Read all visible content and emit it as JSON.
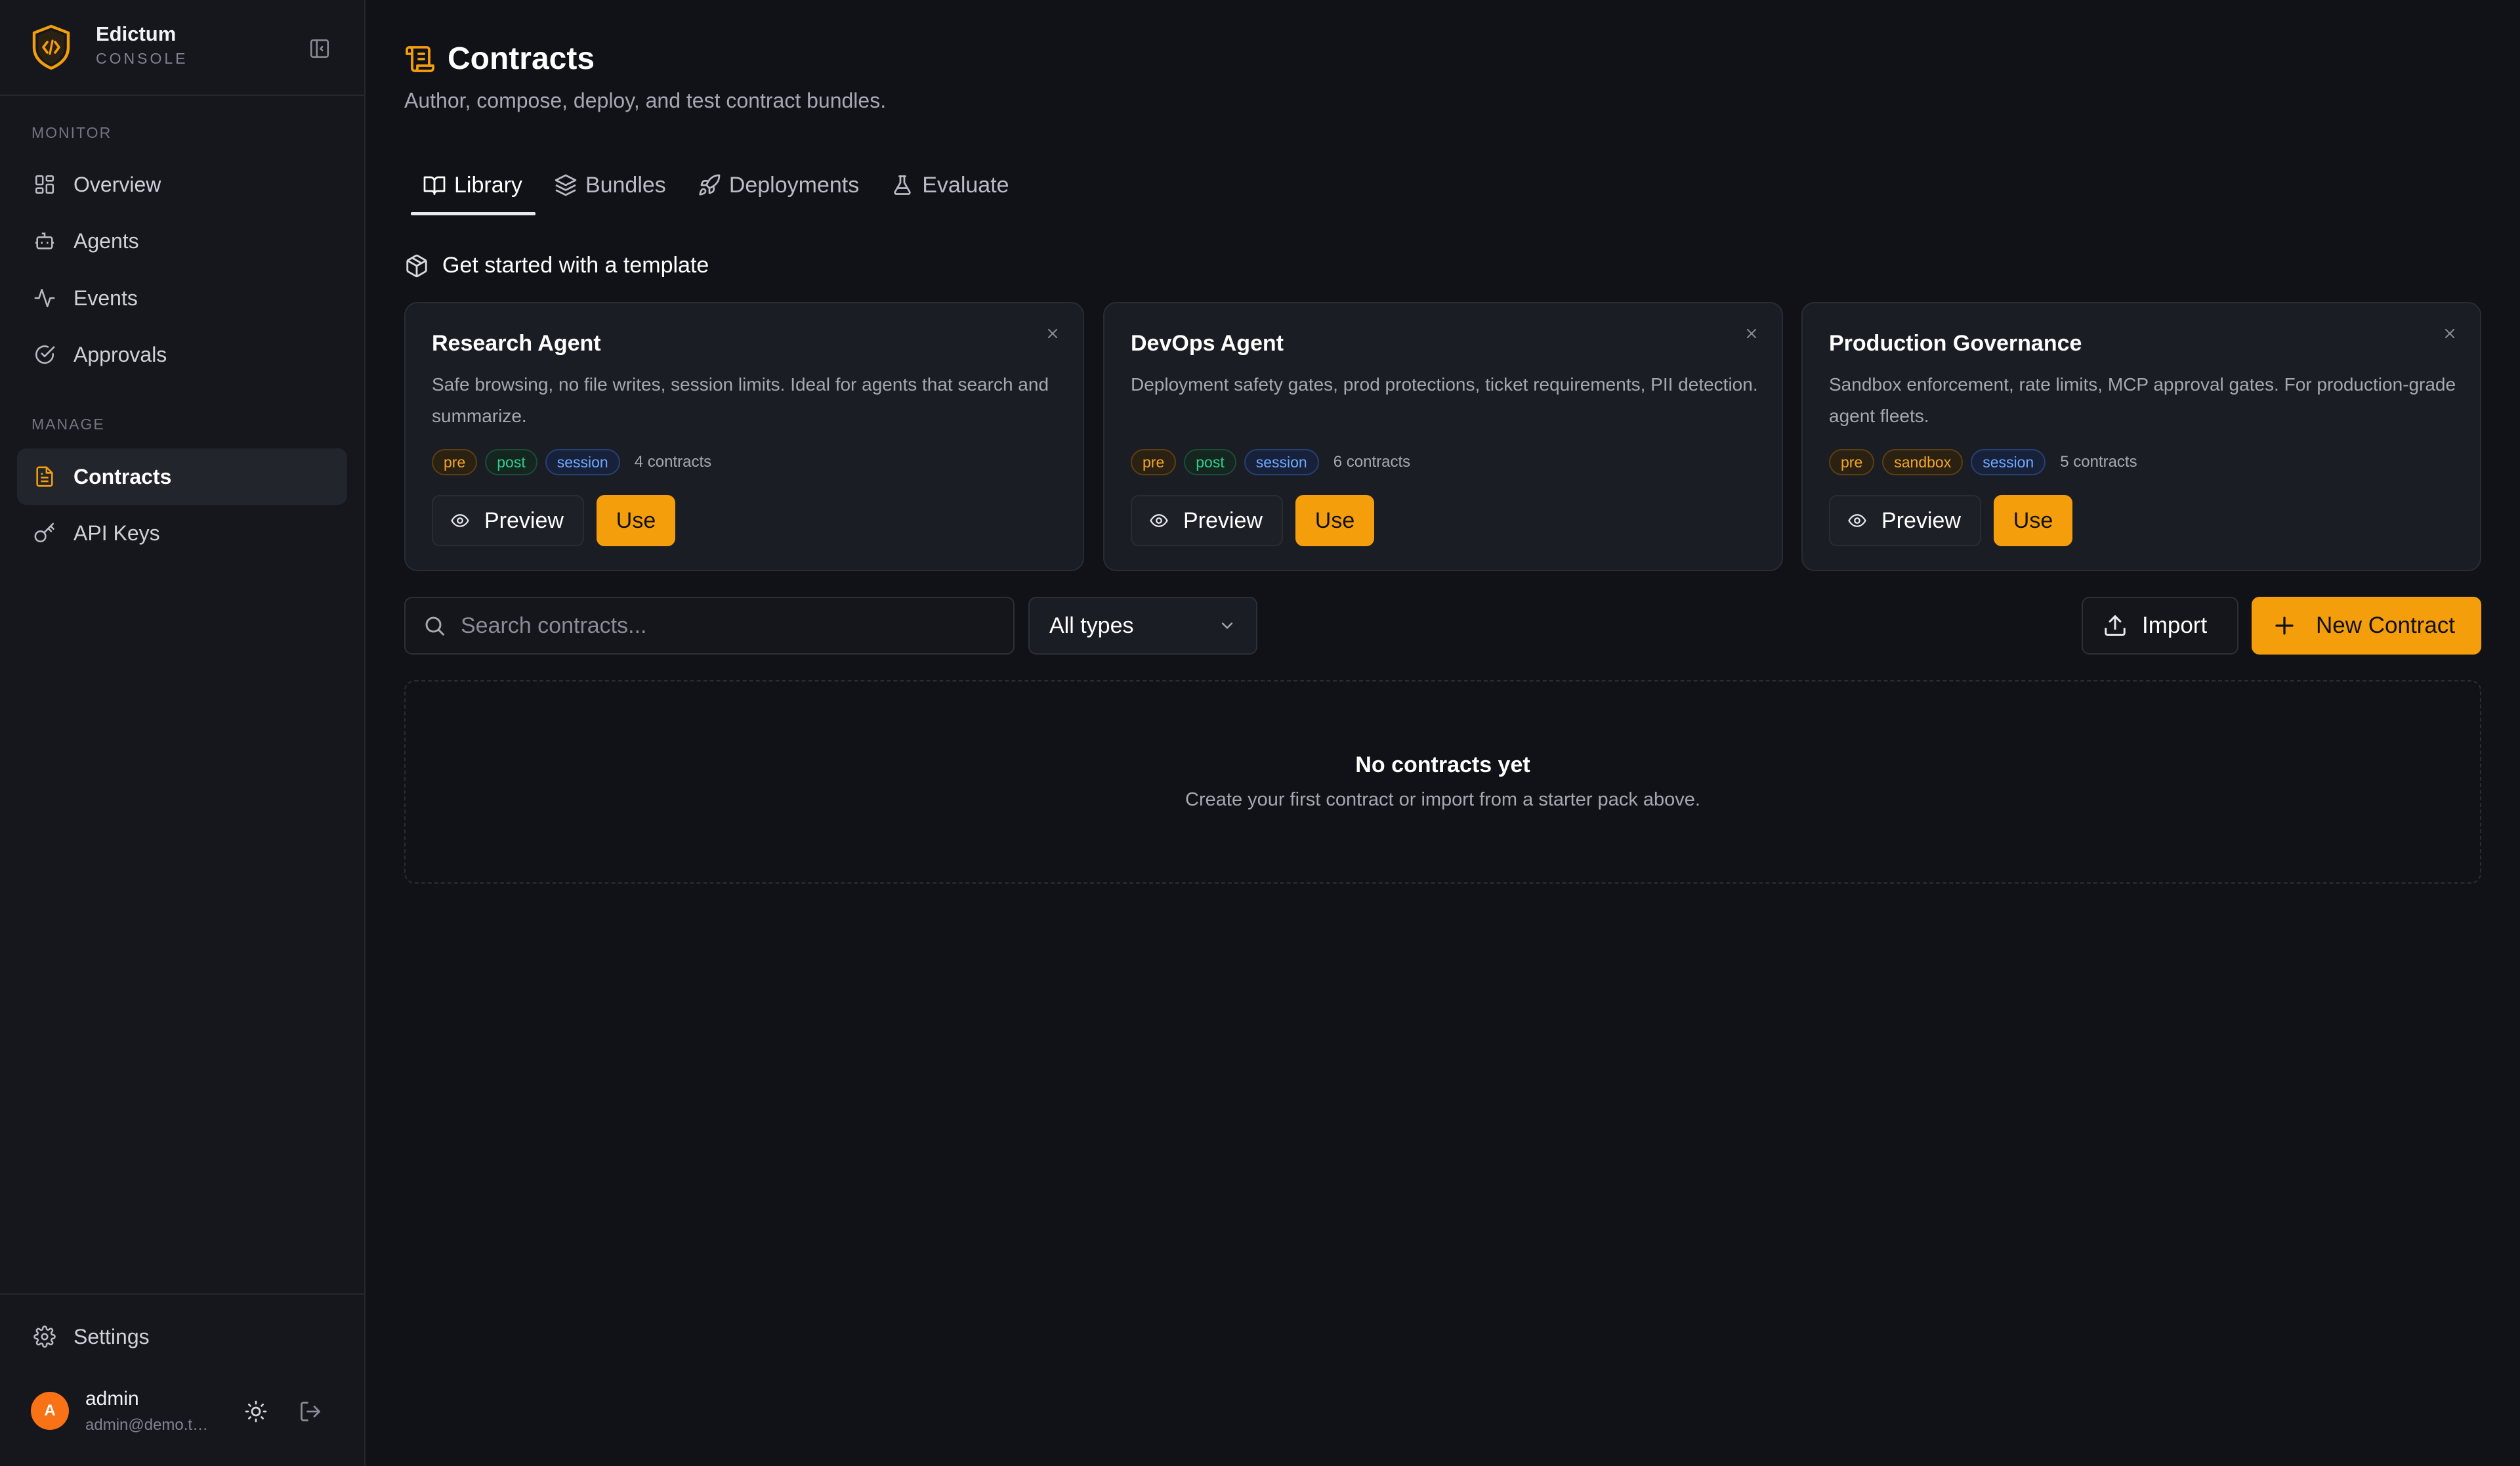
{
  "brand": {
    "name": "Edictum",
    "subtitle": "CONSOLE"
  },
  "sidebar": {
    "sections": [
      {
        "label": "MONITOR"
      },
      {
        "label": "MANAGE"
      }
    ],
    "items": [
      {
        "label": "Overview",
        "icon": "grid-icon"
      },
      {
        "label": "Agents",
        "icon": "bot-icon"
      },
      {
        "label": "Events",
        "icon": "activity-icon"
      },
      {
        "label": "Approvals",
        "icon": "check-circle-icon"
      },
      {
        "label": "Contracts",
        "icon": "document-icon",
        "active": true
      },
      {
        "label": "API Keys",
        "icon": "key-icon"
      }
    ],
    "settings_label": "Settings"
  },
  "user": {
    "initial": "A",
    "name": "admin",
    "email": "admin@demo.test"
  },
  "page": {
    "title": "Contracts",
    "subtitle": "Author, compose, deploy, and test contract bundles."
  },
  "tabs": [
    {
      "label": "Library",
      "active": true
    },
    {
      "label": "Bundles"
    },
    {
      "label": "Deployments"
    },
    {
      "label": "Evaluate"
    }
  ],
  "templates": {
    "heading": "Get started with a template",
    "cards": [
      {
        "title": "Research Agent",
        "description": "Safe browsing, no file writes, session limits. Ideal for agents that search and summarize.",
        "tags": [
          "pre",
          "post",
          "session"
        ],
        "count": "4 contracts",
        "preview_label": "Preview",
        "use_label": "Use"
      },
      {
        "title": "DevOps Agent",
        "description": "Deployment safety gates, prod protections, ticket requirements, PII detection.",
        "tags": [
          "pre",
          "post",
          "session"
        ],
        "count": "6 contracts",
        "preview_label": "Preview",
        "use_label": "Use"
      },
      {
        "title": "Production Governance",
        "description": "Sandbox enforcement, rate limits, MCP approval gates. For production-grade agent fleets.",
        "tags": [
          "pre",
          "sandbox",
          "session"
        ],
        "count": "5 contracts",
        "preview_label": "Preview",
        "use_label": "Use"
      }
    ]
  },
  "toolbar": {
    "search_placeholder": "Search contracts...",
    "search_value": "",
    "type_filter": "All types",
    "import_label": "Import",
    "new_label": "New Contract"
  },
  "empty_state": {
    "title": "No contracts yet",
    "subtitle": "Create your first contract or import from a starter pack above."
  },
  "colors": {
    "accent": "#f59e0b",
    "background": "#111217",
    "sidebar": "#16171d",
    "card": "#1b1d24",
    "tag_amber": "#f5a524",
    "tag_green": "#2fcf8e",
    "tag_blue": "#6ea8ff",
    "avatar": "#f97316"
  }
}
